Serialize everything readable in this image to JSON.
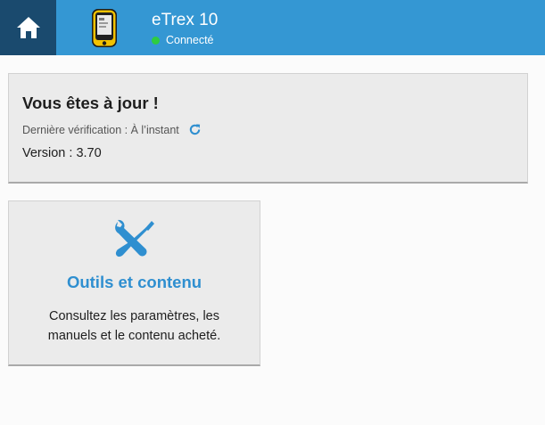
{
  "header": {
    "device_name": "eTrex 10",
    "status_text": "Connecté",
    "home_icon": "home-icon",
    "device_icon": "gps-device-icon",
    "colors": {
      "bar": "#3497d3",
      "home_bg": "#1a4a6e",
      "status_dot": "#2ecc40"
    }
  },
  "update": {
    "title": "Vous êtes à jour !",
    "last_check_label": "Dernière vérification : À l’instant",
    "refresh_icon": "refresh-icon",
    "version_label": "Version : 3.70"
  },
  "tools": {
    "icon": "tools-icon",
    "title": "Outils et contenu",
    "description": "Consultez les paramètres, les manuels et le contenu acheté.",
    "accent": "#2f8fd0"
  }
}
